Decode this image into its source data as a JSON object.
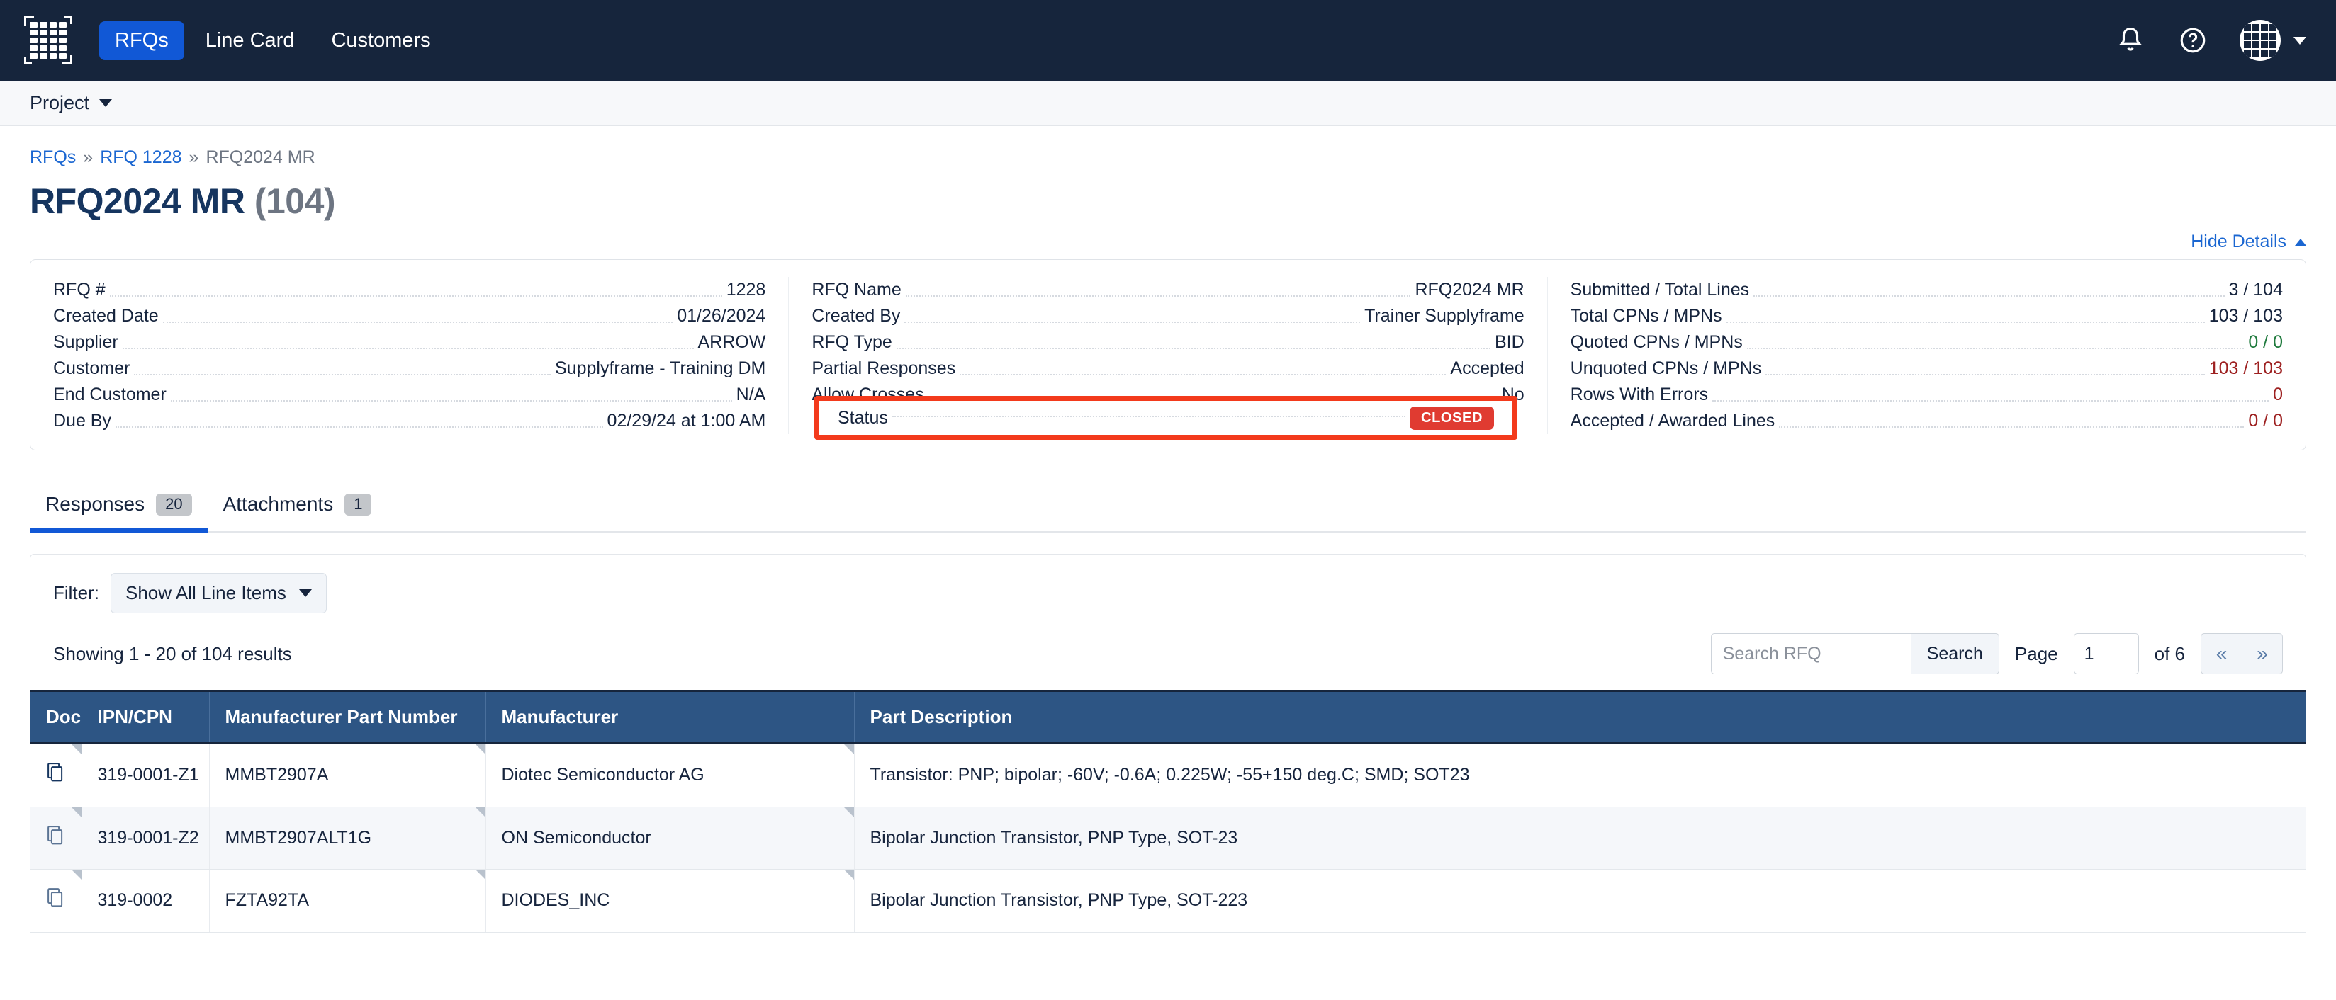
{
  "topnav": {
    "logo_icon": "grid-logo-icon",
    "items": [
      {
        "label": "RFQs",
        "active": true
      },
      {
        "label": "Line Card",
        "active": false
      },
      {
        "label": "Customers",
        "active": false
      }
    ],
    "notification_icon": "bell-icon",
    "help_icon": "question-circle-icon",
    "avatar_icon": "grid-avatar",
    "account_chevron_icon": "chevron-down-icon",
    "accent_color": "#1158d6",
    "bg_color": "#16253c"
  },
  "projectbar": {
    "label": "Project",
    "chevron_icon": "chevron-down-icon"
  },
  "breadcrumb": {
    "items": [
      {
        "label": "RFQs",
        "link": true
      },
      {
        "label": "RFQ 1228",
        "link": true
      },
      {
        "label": "RFQ2024 MR",
        "link": false
      }
    ],
    "separator": "»"
  },
  "header": {
    "title": "RFQ2024 MR",
    "count": "(104)",
    "hide_details_label": "Hide Details",
    "hide_details_icon": "chevron-up-icon"
  },
  "details": {
    "col1": [
      {
        "label": "RFQ #",
        "value": "1228"
      },
      {
        "label": "Created Date",
        "value": "01/26/2024"
      },
      {
        "label": "Supplier",
        "value": "ARROW"
      },
      {
        "label": "Customer",
        "value": "Supplyframe - Training DM"
      },
      {
        "label": "End Customer",
        "value": "N/A"
      },
      {
        "label": "Due By",
        "value": "02/29/24 at 1:00 AM"
      }
    ],
    "col2": [
      {
        "label": "RFQ Name",
        "value": "RFQ2024 MR"
      },
      {
        "label": "Created By",
        "value": "Trainer Supplyframe"
      },
      {
        "label": "RFQ Type",
        "value": "BID"
      },
      {
        "label": "Partial Responses",
        "value": "Accepted"
      },
      {
        "label": "Allow Crosses",
        "value": "No"
      }
    ],
    "status_row": {
      "label": "Status",
      "badge": "CLOSED",
      "badge_color": "#e03b31",
      "highlight_color": "#f33a1c"
    },
    "col3": [
      {
        "label": "Submitted / Total Lines",
        "value": "3 / 104",
        "color": ""
      },
      {
        "label": "Total CPNs / MPNs",
        "value": "103 / 103",
        "color": ""
      },
      {
        "label": "Quoted CPNs / MPNs",
        "value": "0 / 0",
        "color": "green"
      },
      {
        "label": "Unquoted CPNs / MPNs",
        "value": "103 / 103",
        "color": "red"
      },
      {
        "label": "Rows With Errors",
        "value": "0",
        "color": "red"
      },
      {
        "label": "Accepted / Awarded Lines",
        "value": "0 / 0",
        "color": "red"
      }
    ]
  },
  "tabs": [
    {
      "label": "Responses",
      "badge": "20",
      "active": true
    },
    {
      "label": "Attachments",
      "badge": "1",
      "active": false
    }
  ],
  "filter": {
    "label": "Filter:",
    "selected": "Show All Line Items",
    "chevron_icon": "chevron-down-icon"
  },
  "results": {
    "showing_text": "Showing 1 - 20 of 104 results",
    "search_placeholder": "Search RFQ",
    "search_value": "",
    "search_button": "Search",
    "page_label": "Page",
    "page_value": "1",
    "of_label": "of 6",
    "prev_icon": "«",
    "next_icon": "»"
  },
  "table": {
    "columns": [
      "Doc",
      "IPN/CPN",
      "Manufacturer Part Number",
      "Manufacturer",
      "Part Description"
    ],
    "header_bg": "#2d5584",
    "rows": [
      {
        "doc_icon": "copy-document-icon",
        "ipn_cpn": "319-0001-Z1",
        "mpn": "MMBT2907A",
        "manufacturer": "Diotec Semiconductor AG",
        "description": "Transistor: PNP; bipolar; -60V; -0.6A; 0.225W; -55+150 deg.C; SMD; SOT23"
      },
      {
        "doc_icon": "copy-document-icon",
        "ipn_cpn": "319-0001-Z2",
        "mpn": "MMBT2907ALT1G",
        "manufacturer": "ON Semiconductor",
        "description": "Bipolar Junction Transistor, PNP Type, SOT-23"
      },
      {
        "doc_icon": "copy-document-icon",
        "ipn_cpn": "319-0002",
        "mpn": "FZTA92TA",
        "manufacturer": "DIODES_INC",
        "description": "Bipolar Junction Transistor, PNP Type, SOT-223"
      }
    ]
  }
}
